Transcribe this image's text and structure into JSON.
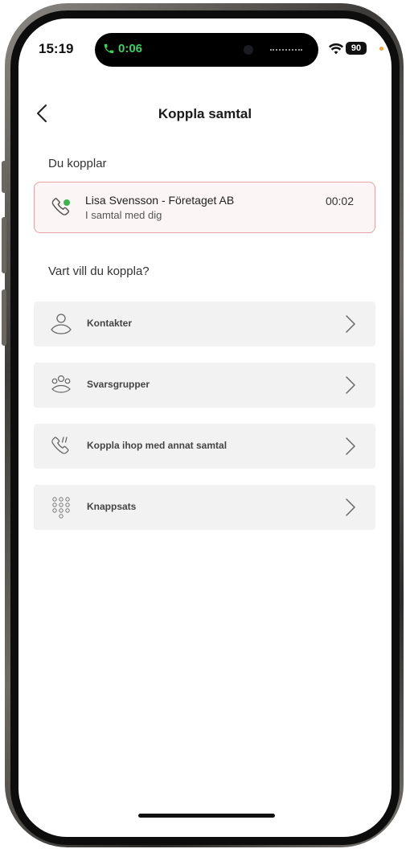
{
  "status_bar": {
    "time": "15:19",
    "call_duration": "0:06",
    "battery": "90",
    "call_color": "#3bd160"
  },
  "header": {
    "title": "Koppla samtal",
    "back_icon": "chevron-left-icon"
  },
  "current_call": {
    "section_label": "Du kopplar",
    "name": "Lisa Svensson - Företaget AB",
    "status": "I samtal med dig",
    "timer": "00:02",
    "icon": "phone-active-icon",
    "border_color": "#e8a2a6"
  },
  "transfer": {
    "section_label": "Vart vill du koppla?",
    "options": [
      {
        "label": "Kontakter",
        "icon": "contact-person-icon"
      },
      {
        "label": "Svarsgrupper",
        "icon": "group-icon"
      },
      {
        "label": "Koppla ihop med annat samtal",
        "icon": "phone-ringing-icon"
      },
      {
        "label": "Knappsats",
        "icon": "keypad-icon"
      }
    ]
  }
}
